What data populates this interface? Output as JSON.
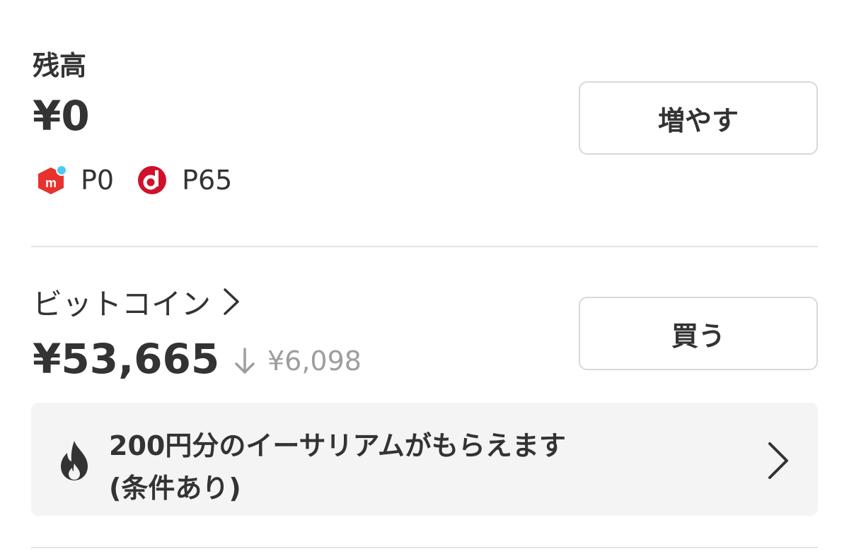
{
  "balance": {
    "label": "残高",
    "amount": "¥0",
    "increase_label": "増やす",
    "points": [
      {
        "icon": "merpay-point-icon",
        "text": "P0"
      },
      {
        "icon": "d-point-icon",
        "text": "P65"
      }
    ]
  },
  "bitcoin": {
    "label": "ビットコイン",
    "value": "¥53,665",
    "change": "¥6,098",
    "change_direction": "down",
    "buy_label": "買う"
  },
  "promo": {
    "line1": "200円分のイーサリアムがもらえます",
    "line2": "(条件あり)",
    "icon": "flame-icon"
  },
  "colors": {
    "merpay_red": "#e8322d",
    "merpay_blue": "#4dc9f6",
    "d_point_red": "#d0112b",
    "muted_text": "#9e9e9e",
    "banner_bg": "#f4f4f4"
  }
}
